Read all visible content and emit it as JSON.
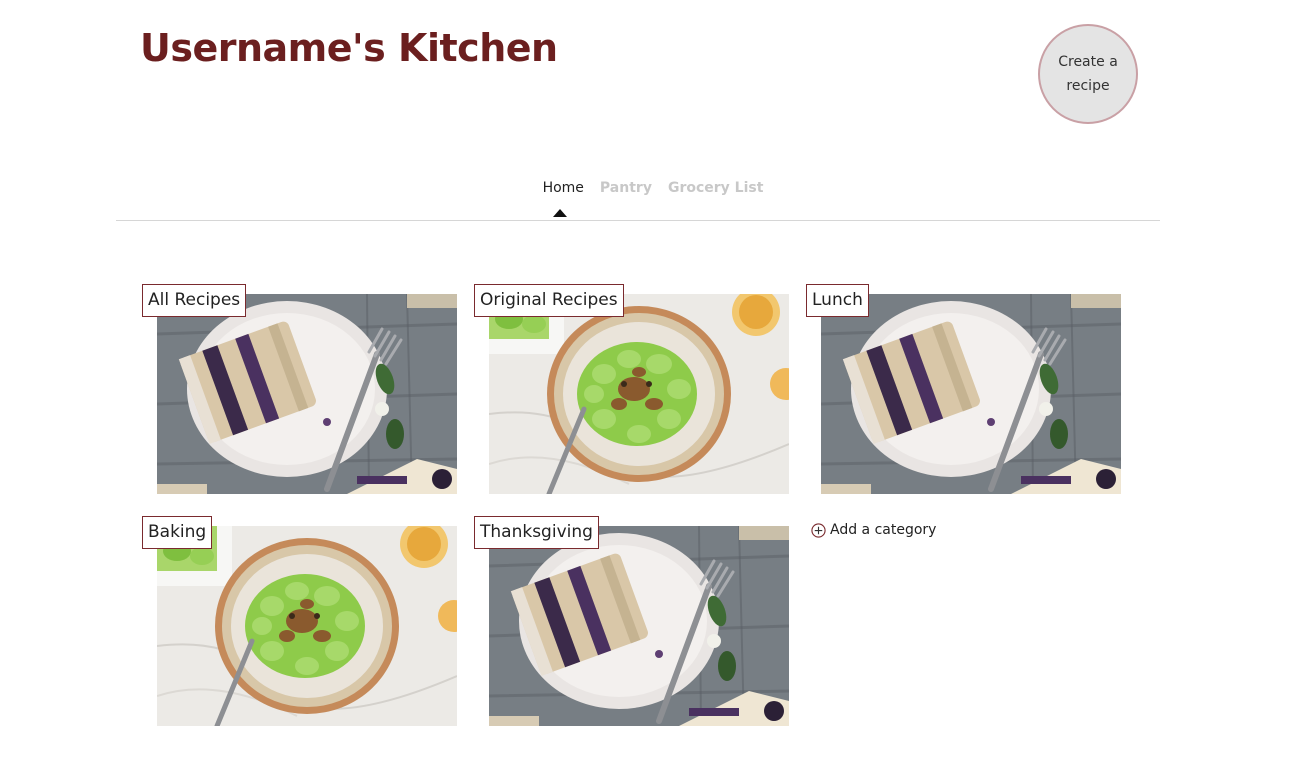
{
  "header": {
    "title": "Username's Kitchen",
    "create_button": "Create a recipe"
  },
  "nav": {
    "tabs": [
      {
        "label": "Home",
        "active": true
      },
      {
        "label": "Pantry",
        "active": false
      },
      {
        "label": "Grocery List",
        "active": false
      }
    ]
  },
  "categories": [
    {
      "label": "All Recipes",
      "image": "cake-photo"
    },
    {
      "label": "Original Recipes",
      "image": "pasta-photo"
    },
    {
      "label": "Lunch",
      "image": "cake-photo"
    },
    {
      "label": "Baking",
      "image": "pasta-photo"
    },
    {
      "label": "Thanksgiving",
      "image": "cake-photo"
    }
  ],
  "add_category": {
    "label": "Add a category",
    "icon": "plus-circle-icon"
  },
  "colors": {
    "brand": "#6b1f1f",
    "label_border": "#7a2a2e",
    "inactive_tab": "#c8c8c8"
  }
}
